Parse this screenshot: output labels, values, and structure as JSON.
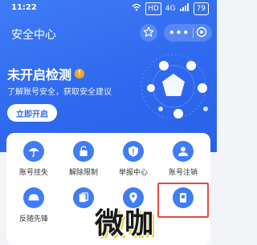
{
  "status_bar": {
    "time": "11:22",
    "signal_label": "HD",
    "network_label": "4G",
    "battery": "79"
  },
  "header": {
    "title": "安全中心"
  },
  "hero": {
    "headline": "未开启检测",
    "subtitle": "了解账号安全，获取安全建议",
    "enable_label": "立即开启"
  },
  "services": [
    {
      "label": "账号挂失",
      "icon": "umbrella-icon"
    },
    {
      "label": "解除限制",
      "icon": "unlock-icon"
    },
    {
      "label": "举报中心",
      "icon": "report-icon"
    },
    {
      "label": "账号注销",
      "icon": "user-cancel-icon"
    },
    {
      "label": "反随先锋",
      "icon": "shield-hat-icon"
    },
    {
      "label": "",
      "icon": "cards-icon"
    },
    {
      "label": "",
      "icon": "pin-icon"
    },
    {
      "label": "",
      "icon": "device-icon"
    }
  ],
  "watermark": "微咖",
  "colors": {
    "brand_blue": "#2f69ef",
    "warning": "#f6a623",
    "highlight": "#e84b3c"
  }
}
